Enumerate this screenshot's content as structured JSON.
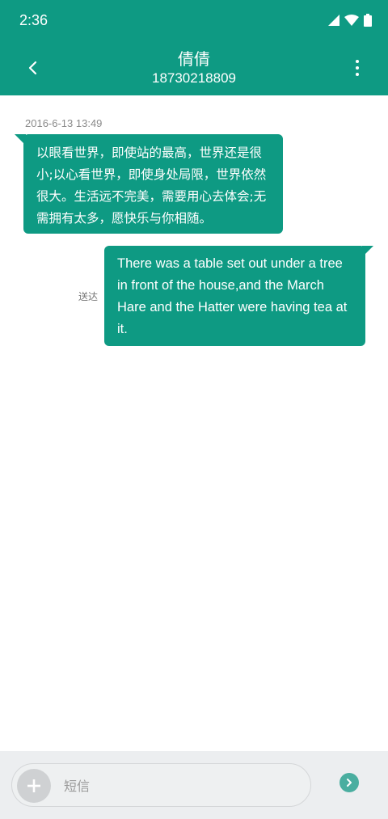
{
  "status_bar": {
    "time": "2:36",
    "icons": [
      "signal-icon",
      "wifi-icon",
      "battery-icon"
    ]
  },
  "header": {
    "title": "倩倩",
    "subtitle": "18730218809",
    "back_icon": "chevron-left-icon",
    "menu_icon": "more-vert-icon"
  },
  "conversation": {
    "timestamp": "2016-6-13 13:49",
    "messages": [
      {
        "direction": "incoming",
        "text": "以眼看世界，即使站的最高，世界还是很小;以心看世界，即使身处局限，世界依然很大。生活远不完美，需要用心去体会;无需拥有太多，愿快乐与你相随。"
      },
      {
        "direction": "outgoing",
        "text": "There was a table set out under a tree in front of the house,and the March Hare and the Hatter were having tea at it.",
        "status": "送达"
      }
    ]
  },
  "composer": {
    "placeholder": "短信",
    "value": "",
    "add_icon": "plus-icon",
    "send_icon": "send-arrow-icon"
  },
  "colors": {
    "primary": "#0e9a83",
    "send": "#4aaea0",
    "composer_bg": "#eceef0"
  }
}
